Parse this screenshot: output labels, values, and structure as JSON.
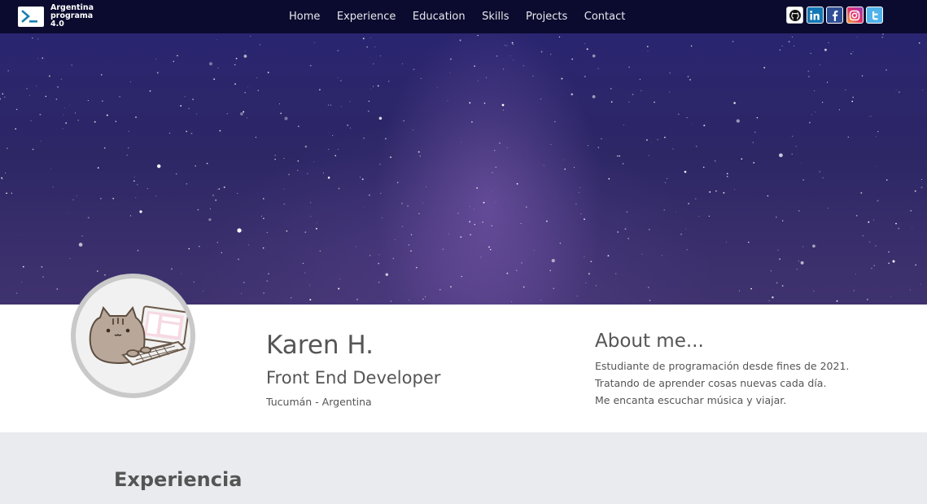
{
  "brand": {
    "line1": "Argentina",
    "line2": "programa",
    "line3": "4.0",
    "logo_icon": "terminal-prompt-icon"
  },
  "nav": {
    "items": [
      {
        "label": "Home"
      },
      {
        "label": "Experience"
      },
      {
        "label": "Education"
      },
      {
        "label": "Skills"
      },
      {
        "label": "Projects"
      },
      {
        "label": "Contact"
      }
    ]
  },
  "socials": [
    {
      "icon": "github-icon",
      "color": "#ffffff"
    },
    {
      "icon": "linkedin-icon",
      "color": "#1277b5"
    },
    {
      "icon": "facebook-icon",
      "color": "#2f4f95"
    },
    {
      "icon": "instagram-icon",
      "color": "#e1306c"
    },
    {
      "icon": "twitter-icon",
      "color": "#4fb3ea"
    }
  ],
  "banner": {
    "image": "starry-night-sky"
  },
  "profile": {
    "avatar": "pusheen-cat-with-laptop",
    "name": "Karen H.",
    "role": "Front End Developer",
    "location": "Tucumán - Argentina"
  },
  "about": {
    "title": "About me...",
    "lines": [
      "Estudiante de programación desde fines de 2021.",
      "Tratando de aprender cosas nuevas cada día.",
      "Me encanta escuchar música y viajar."
    ]
  },
  "experience": {
    "title": "Experiencia"
  },
  "colors": {
    "navbar": "#0b0b2f",
    "section_bg": "#e9ebef",
    "text": "#555555"
  }
}
